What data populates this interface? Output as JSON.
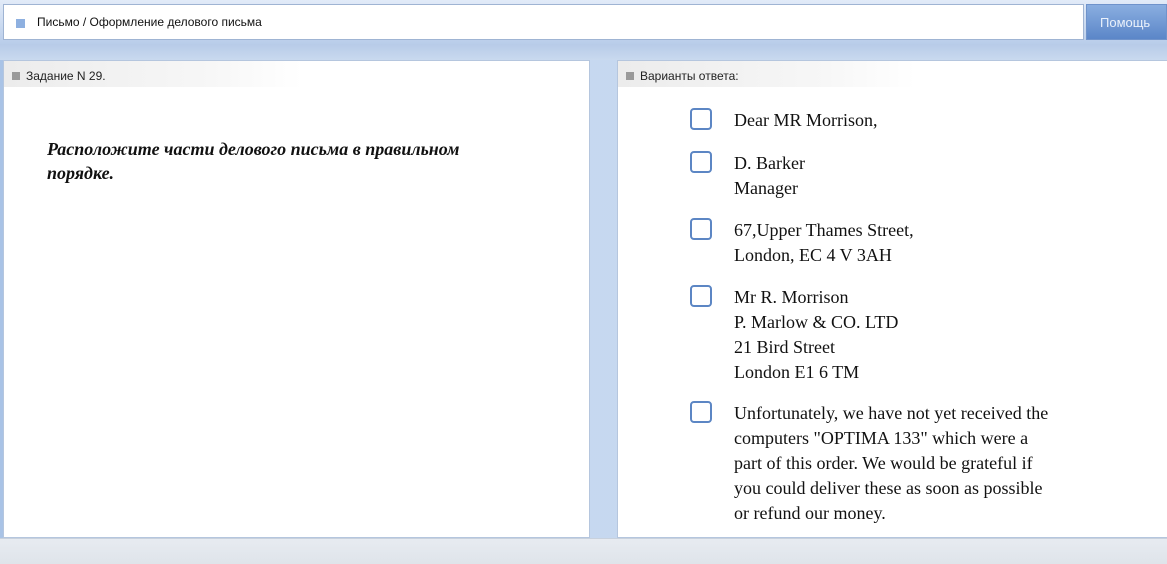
{
  "header": {
    "breadcrumb": "Письмо / Оформление делового письма",
    "help_label": "Помощь"
  },
  "task_panel": {
    "title": "Задание N 29.",
    "question": "Расположите части делового письма в правильном порядке."
  },
  "answers_panel": {
    "title": "Варианты ответа:",
    "options": [
      {
        "lines": [
          "Dear MR Morrison,"
        ]
      },
      {
        "lines": [
          "D. Barker",
          "Manager"
        ]
      },
      {
        "lines": [
          "67,Upper Thames Street,",
          "London, EC 4 V 3AH"
        ]
      },
      {
        "lines": [
          "Mr R. Morrison",
          "P. Marlow & CO. LTD",
          "21 Bird Street",
          "London E1 6 TM"
        ]
      },
      {
        "lines": [
          "Unfortunately, we have not yet received the",
          "computers \"OPTIMA 133\" which were a",
          "part of this order. We would be grateful if",
          "you could deliver these as soon as possible",
          "or refund our money."
        ]
      }
    ]
  },
  "colors": {
    "accent": "#5c86c4",
    "help_button": "#6f93cb",
    "page_background": "#c6d8ef"
  }
}
